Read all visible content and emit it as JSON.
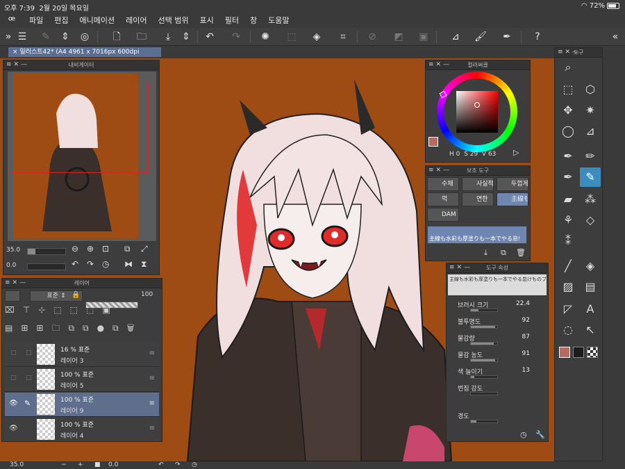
{
  "status": {
    "time": "오후 7:39",
    "date": "2월 20일 목요일",
    "battery": "72%"
  },
  "menu": [
    "파일",
    "편집",
    "애니메이션",
    "레이어",
    "선택 범위",
    "표시",
    "필터",
    "창",
    "도움말"
  ],
  "document": {
    "tab_title": "일러스트42* (A4 4961 x 7016px 600dpi 35.0%)"
  },
  "navigator": {
    "title": "내비게이터",
    "zoom": "35.0",
    "rotation": "0.0"
  },
  "layers": {
    "title": "레이어",
    "blend_mode": "표준",
    "opacity": "100",
    "items": [
      {
        "mode": "16 % 표준",
        "name": "레이어 3"
      },
      {
        "mode": "100 % 표준",
        "name": "레이어 5"
      },
      {
        "mode": "100 % 표준",
        "name": "레이어 9"
      },
      {
        "mode": "100 % 표준",
        "name": "레이어 4"
      }
    ]
  },
  "color_wheel": {
    "title": "컬러써클",
    "h_label": "H",
    "h": "0",
    "s_label": "S",
    "s": "29",
    "v_label": "V",
    "v": "63"
  },
  "subtool": {
    "title": "보조 도구",
    "items": [
      "수채",
      "사실적",
      "두껍게",
      "먹",
      "연한",
      "主線も",
      "DAM"
    ],
    "preview_text": "主線も水彩も厚塗りも一本でやる怠!"
  },
  "tool_property": {
    "title": "도구 속성",
    "preview_text": "主線も水彩も厚塗りも一本でやる怠けものブラシ",
    "props": [
      {
        "label": "브러시 크기",
        "value": "22.4",
        "fill": 0.3
      },
      {
        "label": "불투명도",
        "value": "92",
        "fill": 0.92
      },
      {
        "label": "물감량",
        "value": "87",
        "fill": 0.87
      },
      {
        "label": "물감 농도",
        "value": "91",
        "fill": 0.91
      },
      {
        "label": "색 늘이기",
        "value": "13",
        "fill": 0.13
      },
      {
        "label": "번짐 강도",
        "value": "",
        "fill": 0.0
      },
      {
        "label": "경도",
        "value": "",
        "fill": 0.2
      }
    ]
  },
  "tools": {
    "title": "도구"
  },
  "bottom": {
    "zoom": "35.0",
    "rotation": "0.0"
  },
  "colors": {
    "canvas": "#9e4c14",
    "accent": "#3c8cbd",
    "main_color": "#b56a64"
  }
}
